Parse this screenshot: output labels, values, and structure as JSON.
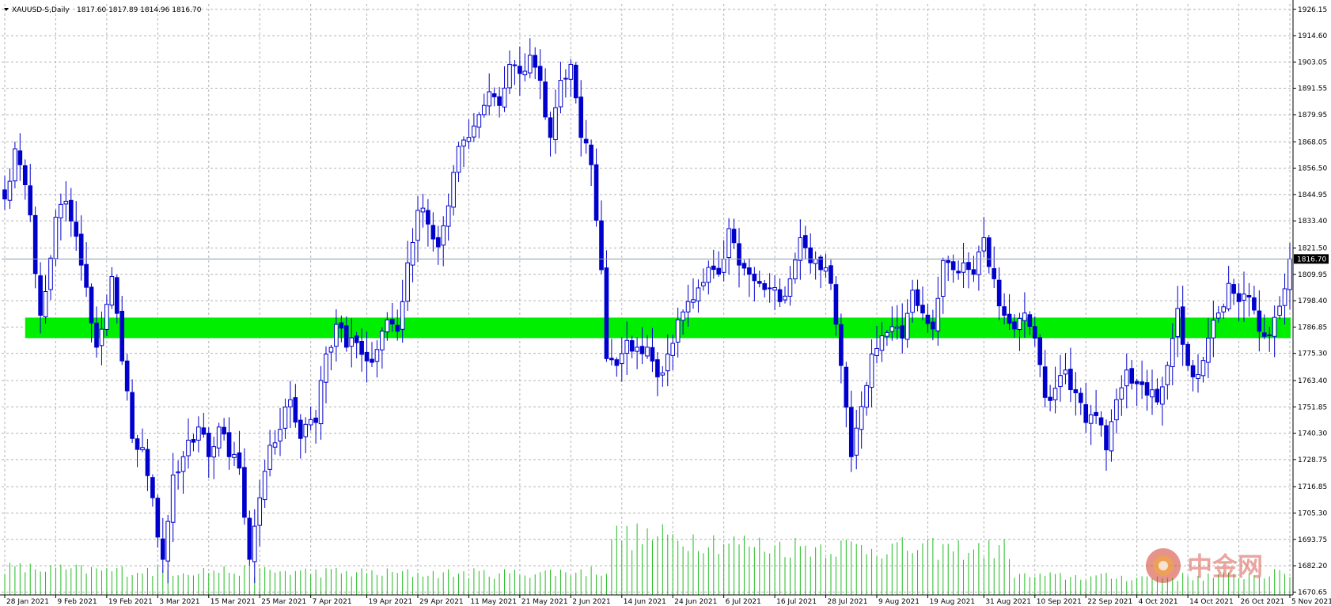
{
  "header": {
    "symbol": "XAUUSD-S,Daily",
    "ohlc": "1817.60 1817.89 1814.96 1816.70"
  },
  "colors": {
    "background": "#ffffff",
    "grid": "#b4b4b4",
    "candle_line": "#0000cc",
    "bear_body": "#0000cc",
    "bull_body": "#ffffff",
    "zone": "#00ee00",
    "volume": "#22bb22",
    "price_line": "#8899aa"
  },
  "watermark": {
    "text": "中金网",
    "icon": "zhongjin-logo-icon"
  },
  "chart_data": {
    "type": "candlestick",
    "symbol": "XAUUSD-S",
    "timeframe": "Daily",
    "ylim": [
      1669.4,
      1928.5
    ],
    "current_price": 1816.7,
    "current_price_label": "1816.70",
    "y_ticks": [
      "1926.15",
      "1914.60",
      "1903.05",
      "1891.55",
      "1879.95",
      "1868.05",
      "1856.50",
      "1844.95",
      "1833.40",
      "1821.50",
      "1809.95",
      "1798.40",
      "1786.85",
      "1775.30",
      "1763.40",
      "1751.85",
      "1740.30",
      "1728.75",
      "1716.85",
      "1705.30",
      "1693.75",
      "1682.20",
      "1670.65"
    ],
    "x_ticks": [
      "28 Jan 2021",
      "9 Feb 2021",
      "19 Feb 2021",
      "3 Mar 2021",
      "15 Mar 2021",
      "25 Mar 2021",
      "7 Apr 2021",
      "19 Apr 2021",
      "29 Apr 2021",
      "11 May 2021",
      "21 May 2021",
      "2 Jun 2021",
      "14 Jun 2021",
      "24 Jun 2021",
      "6 Jul 2021",
      "16 Jul 2021",
      "28 Jul 2021",
      "9 Aug 2021",
      "19 Aug 2021",
      "31 Aug 2021",
      "10 Sep 2021",
      "22 Sep 2021",
      "4 Oct 2021",
      "14 Oct 2021",
      "26 Oct 2021",
      "5 Nov 2021"
    ],
    "zone": {
      "from": 1782,
      "to": 1791
    },
    "anchors": [
      {
        "i": 0,
        "c": 1843
      },
      {
        "i": 2,
        "c": 1865
      },
      {
        "i": 5,
        "c": 1836
      },
      {
        "i": 7,
        "c": 1792
      },
      {
        "i": 10,
        "c": 1835
      },
      {
        "i": 12,
        "c": 1842
      },
      {
        "i": 15,
        "c": 1814
      },
      {
        "i": 18,
        "c": 1778
      },
      {
        "i": 21,
        "c": 1809
      },
      {
        "i": 23,
        "c": 1772
      },
      {
        "i": 25,
        "c": 1738
      },
      {
        "i": 27,
        "c": 1734
      },
      {
        "i": 29,
        "c": 1712
      },
      {
        "i": 31,
        "c": 1685
      },
      {
        "i": 33,
        "c": 1722
      },
      {
        "i": 35,
        "c": 1730
      },
      {
        "i": 38,
        "c": 1743
      },
      {
        "i": 40,
        "c": 1730
      },
      {
        "i": 42,
        "c": 1743
      },
      {
        "i": 44,
        "c": 1730
      },
      {
        "i": 46,
        "c": 1725
      },
      {
        "i": 48,
        "c": 1685
      },
      {
        "i": 50,
        "c": 1712
      },
      {
        "i": 52,
        "c": 1735
      },
      {
        "i": 54,
        "c": 1742
      },
      {
        "i": 56,
        "c": 1755
      },
      {
        "i": 58,
        "c": 1738
      },
      {
        "i": 61,
        "c": 1745
      },
      {
        "i": 63,
        "c": 1775
      },
      {
        "i": 65,
        "c": 1788
      },
      {
        "i": 67,
        "c": 1778
      },
      {
        "i": 69,
        "c": 1780
      },
      {
        "i": 71,
        "c": 1772
      },
      {
        "i": 73,
        "c": 1777
      },
      {
        "i": 75,
        "c": 1790
      },
      {
        "i": 77,
        "c": 1785
      },
      {
        "i": 79,
        "c": 1815
      },
      {
        "i": 81,
        "c": 1838
      },
      {
        "i": 83,
        "c": 1832
      },
      {
        "i": 85,
        "c": 1822
      },
      {
        "i": 87,
        "c": 1840
      },
      {
        "i": 89,
        "c": 1866
      },
      {
        "i": 91,
        "c": 1870
      },
      {
        "i": 93,
        "c": 1880
      },
      {
        "i": 95,
        "c": 1890
      },
      {
        "i": 97,
        "c": 1884
      },
      {
        "i": 99,
        "c": 1902
      },
      {
        "i": 101,
        "c": 1898
      },
      {
        "i": 103,
        "c": 1906
      },
      {
        "i": 105,
        "c": 1895
      },
      {
        "i": 107,
        "c": 1870
      },
      {
        "i": 109,
        "c": 1895
      },
      {
        "i": 111,
        "c": 1902
      },
      {
        "i": 113,
        "c": 1870
      },
      {
        "i": 115,
        "c": 1858
      },
      {
        "i": 117,
        "c": 1812
      },
      {
        "i": 118,
        "c": 1773
      },
      {
        "i": 120,
        "c": 1770
      },
      {
        "i": 122,
        "c": 1781
      },
      {
        "i": 124,
        "c": 1778
      },
      {
        "i": 126,
        "c": 1778
      },
      {
        "i": 128,
        "c": 1765
      },
      {
        "i": 130,
        "c": 1775
      },
      {
        "i": 132,
        "c": 1790
      },
      {
        "i": 134,
        "c": 1798
      },
      {
        "i": 136,
        "c": 1804
      },
      {
        "i": 138,
        "c": 1813
      },
      {
        "i": 140,
        "c": 1810
      },
      {
        "i": 142,
        "c": 1830
      },
      {
        "i": 144,
        "c": 1814
      },
      {
        "i": 146,
        "c": 1810
      },
      {
        "i": 148,
        "c": 1806
      },
      {
        "i": 150,
        "c": 1804
      },
      {
        "i": 152,
        "c": 1798
      },
      {
        "i": 154,
        "c": 1808
      },
      {
        "i": 156,
        "c": 1826
      },
      {
        "i": 158,
        "c": 1815
      },
      {
        "i": 160,
        "c": 1812
      },
      {
        "i": 162,
        "c": 1806
      },
      {
        "i": 164,
        "c": 1770
      },
      {
        "i": 166,
        "c": 1730
      },
      {
        "i": 168,
        "c": 1752
      },
      {
        "i": 170,
        "c": 1775
      },
      {
        "i": 172,
        "c": 1783
      },
      {
        "i": 174,
        "c": 1787
      },
      {
        "i": 176,
        "c": 1782
      },
      {
        "i": 178,
        "c": 1803
      },
      {
        "i": 180,
        "c": 1793
      },
      {
        "i": 182,
        "c": 1786
      },
      {
        "i": 184,
        "c": 1816
      },
      {
        "i": 186,
        "c": 1812
      },
      {
        "i": 188,
        "c": 1815
      },
      {
        "i": 190,
        "c": 1810
      },
      {
        "i": 192,
        "c": 1826
      },
      {
        "i": 194,
        "c": 1808
      },
      {
        "i": 196,
        "c": 1792
      },
      {
        "i": 198,
        "c": 1786
      },
      {
        "i": 200,
        "c": 1793
      },
      {
        "i": 202,
        "c": 1782
      },
      {
        "i": 204,
        "c": 1756
      },
      {
        "i": 206,
        "c": 1760
      },
      {
        "i": 208,
        "c": 1768
      },
      {
        "i": 210,
        "c": 1758
      },
      {
        "i": 212,
        "c": 1745
      },
      {
        "i": 214,
        "c": 1748
      },
      {
        "i": 216,
        "c": 1733
      },
      {
        "i": 218,
        "c": 1755
      },
      {
        "i": 220,
        "c": 1768
      },
      {
        "i": 222,
        "c": 1762
      },
      {
        "i": 224,
        "c": 1757
      },
      {
        "i": 226,
        "c": 1754
      },
      {
        "i": 228,
        "c": 1770
      },
      {
        "i": 230,
        "c": 1795
      },
      {
        "i": 232,
        "c": 1770
      },
      {
        "i": 234,
        "c": 1766
      },
      {
        "i": 236,
        "c": 1782
      },
      {
        "i": 238,
        "c": 1793
      },
      {
        "i": 240,
        "c": 1806
      },
      {
        "i": 242,
        "c": 1798
      },
      {
        "i": 244,
        "c": 1800
      },
      {
        "i": 246,
        "c": 1785
      },
      {
        "i": 248,
        "c": 1783
      },
      {
        "i": 250,
        "c": 1796
      },
      {
        "i": 252,
        "c": 1816.7
      }
    ],
    "volume_profile": [
      {
        "i": 0,
        "v": 0.1
      },
      {
        "i": 20,
        "v": 0.09
      },
      {
        "i": 40,
        "v": 0.09
      },
      {
        "i": 60,
        "v": 0.085
      },
      {
        "i": 80,
        "v": 0.08
      },
      {
        "i": 100,
        "v": 0.08
      },
      {
        "i": 118,
        "v": 0.09
      },
      {
        "i": 119,
        "v": 0.22
      },
      {
        "i": 135,
        "v": 0.21
      },
      {
        "i": 150,
        "v": 0.18
      },
      {
        "i": 165,
        "v": 0.18
      },
      {
        "i": 180,
        "v": 0.17
      },
      {
        "i": 197,
        "v": 0.17
      },
      {
        "i": 198,
        "v": 0.07
      },
      {
        "i": 225,
        "v": 0.065
      },
      {
        "i": 240,
        "v": 0.07
      },
      {
        "i": 252,
        "v": 0.08
      }
    ]
  }
}
